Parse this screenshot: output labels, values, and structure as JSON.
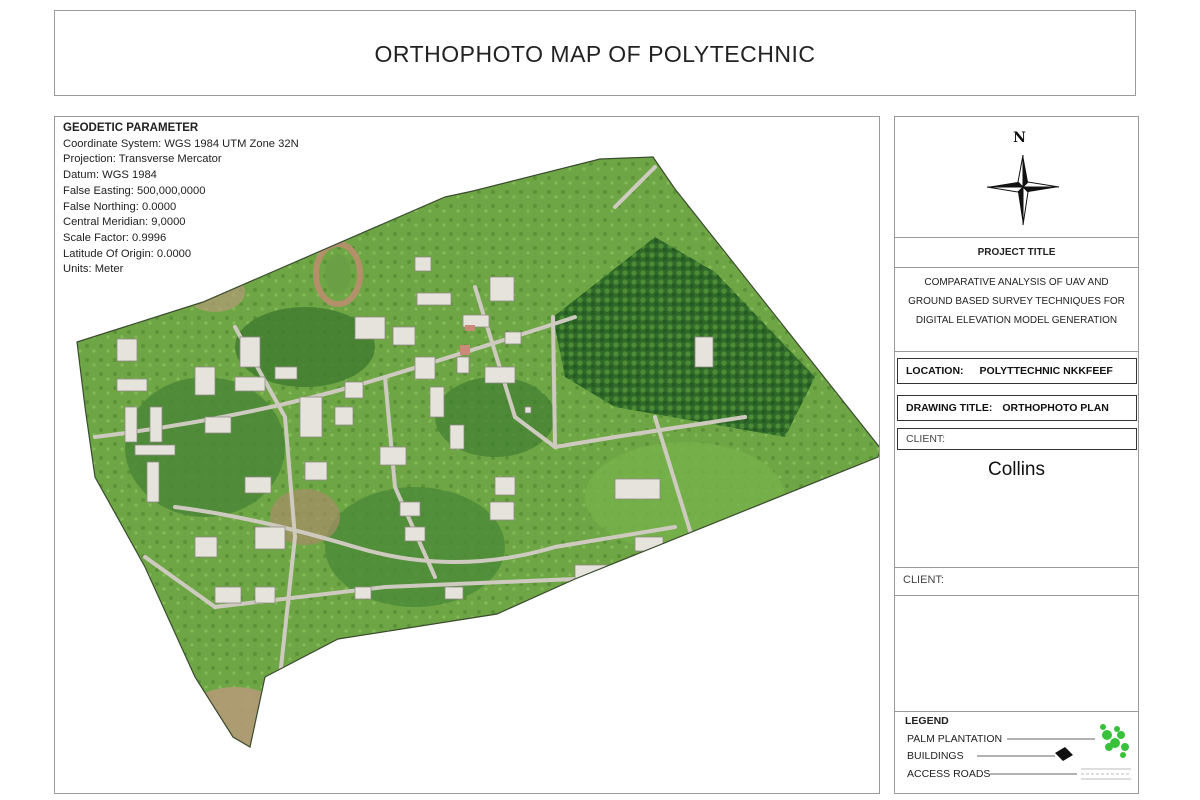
{
  "title": "ORTHOPHOTO MAP OF POLYTECHNIC",
  "geodetic": {
    "heading": "GEODETIC PARAMETER",
    "lines": [
      "Coordinate System: WGS 1984 UTM Zone 32N",
      "Projection: Transverse Mercator",
      "Datum: WGS 1984",
      "False Easting: 500,000,0000",
      "False Northing: 0.0000",
      "Central Meridian: 9,0000",
      "Scale Factor: 0.9996",
      "Latitude Of Origin: 0.0000",
      "Units: Meter"
    ]
  },
  "north_arrow": {
    "label": "N",
    "icon": "north-arrow-icon"
  },
  "project": {
    "heading": "PROJECT TITLE",
    "lines": [
      "COMPARATIVE ANALYSIS OF UAV AND",
      "GROUND BASED SURVEY TECHNIQUES FOR",
      "DIGITAL ELEVATION MODEL GENERATION"
    ]
  },
  "location": {
    "label": "LOCATION:",
    "value": "POLYTTECHNIC NKKFEEF"
  },
  "drawing_title": {
    "label": "DRAWING TITLE:",
    "value": "ORTHOPHOTO PLAN"
  },
  "client1": {
    "label": "CLIENT:",
    "name": "Collins"
  },
  "client2": {
    "label": "CLIENT:"
  },
  "legend": {
    "heading": "LEGEND",
    "items": [
      "PALM PLANTATION",
      "BUILDINGS",
      "ACCESS ROADS"
    ]
  },
  "colors": {
    "vegetation": "#4f8f3a",
    "dense_vegetation": "#2f6a2a",
    "grass": "#7db04f",
    "roads": "#c9c6bd",
    "buildings": "#e4e2dc",
    "bare_ground": "#b49a76",
    "palm_legend": "#38c23a"
  }
}
